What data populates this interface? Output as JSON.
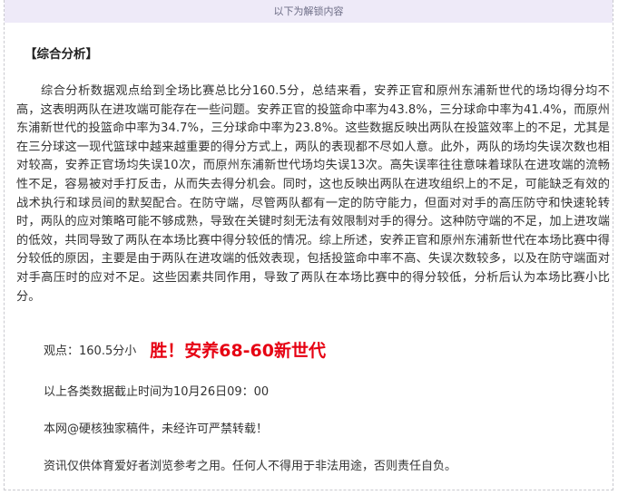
{
  "header": {
    "text": "以下为解锁内容"
  },
  "section_title": "【综合分析】",
  "analysis_paragraph": "综合分析数据观点给到全场比赛总比分160.5分，总结来看，安养正官和原州东浦新世代的场均得分均不高，这表明两队在进攻端可能存在一些问题。安养正官的投篮命中率为43.8%，三分球命中率为41.4%，而原州东浦新世代的投篮命中率为34.7%，三分球命中率为23.8%。这些数据反映出两队在投篮效率上的不足，尤其是在三分球这一现代篮球中越来越重要的得分方式上，两队的表现都不尽如人意。此外，两队的场均失误次数也相对较高，安养正官场均失误10次，而原州东浦新世代场均失误13次。高失误率往往意味着球队在进攻端的流畅性不足，容易被对手打反击，从而失去得分机会。同时，这也反映出两队在进攻组织上的不足，可能缺乏有效的战术执行和球员间的默契配合。在防守端，尽管两队都有一定的防守能力，但面对对手的高压防守和快速轮转时，两队的应对策略可能不够成熟，导致在关键时刻无法有效限制对手的得分。这种防守端的不足，加上进攻端的低效，共同导致了两队在本场比赛中得分较低的情况。综上所述，安养正官和原州东浦新世代在本场比赛中得分较低的原因，主要是由于两队在进攻端的低效表现，包括投篮命中率不高、失误次数较多，以及在防守端面对对手高压时的应对不足。这些因素共同作用，导致了两队在本场比赛中的得分较低，分析后认为本场比赛小比分。",
  "viewpoint": {
    "label": "观点：160.5分小",
    "result": "胜！安养68-60新世代"
  },
  "cutoff_note": "以上各类数据截止时间为10月26日09：00",
  "copyright_note": "本网@硬核独家稿件，未经许可严禁转载！",
  "disclaimer": "资讯仅供体育爱好者浏览参考之用。任何人不得用于非法用途，否则责任自负。",
  "colors": {
    "header_bg": "#eeeaf8",
    "result_red": "#e60012",
    "frame_dash": "#c9c9cf"
  }
}
